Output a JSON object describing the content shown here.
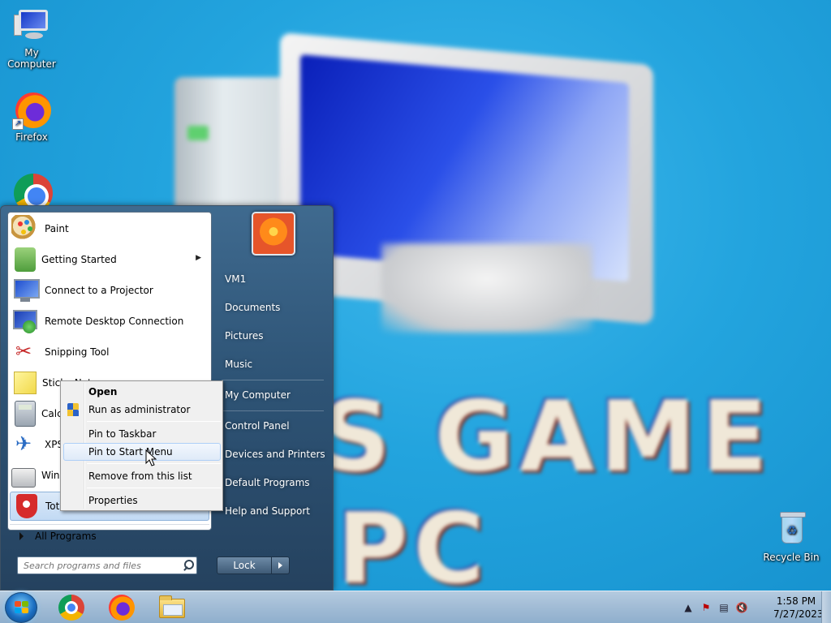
{
  "desktop": {
    "wallpaper_text": [
      "S GAME",
      "PC"
    ],
    "icons": [
      {
        "label": "My Computer",
        "icon": "computer-icon"
      },
      {
        "label": "Firefox",
        "icon": "firefox-icon"
      },
      {
        "label": "",
        "icon": "chrome-icon"
      },
      {
        "label": "Recycle Bin",
        "icon": "recycle-bin-icon"
      }
    ]
  },
  "start_menu": {
    "programs": [
      {
        "label": "Paint",
        "icon": "paint-icon"
      },
      {
        "label": "Getting Started",
        "icon": "getting-started-icon",
        "has_submenu": true
      },
      {
        "label": "Connect to a Projector",
        "icon": "projector-icon"
      },
      {
        "label": "Remote Desktop Connection",
        "icon": "remote-desktop-icon"
      },
      {
        "label": "Snipping Tool",
        "icon": "snipping-tool-icon"
      },
      {
        "label": "Sticky Notes",
        "icon": "sticky-notes-icon"
      },
      {
        "label": "Calculator",
        "icon": "calculator-icon"
      },
      {
        "label": "XPS Viewer",
        "icon": "xps-viewer-icon"
      },
      {
        "label": "Windows Fax and Scan",
        "icon": "fax-scan-icon"
      },
      {
        "label": "Total",
        "icon": "total-security-icon",
        "selected": true
      }
    ],
    "all_programs_label": "All Programs",
    "search_placeholder": "Search programs and files",
    "right_links": [
      "VM1",
      "Documents",
      "Pictures",
      "Music",
      "My Computer",
      "Control Panel",
      "Devices and Printers",
      "Default Programs",
      "Help and Support"
    ],
    "lock_label": "Lock"
  },
  "context_menu": {
    "items": [
      {
        "label": "Open",
        "bold": true
      },
      {
        "label": "Run as administrator",
        "icon": "uac-shield-icon"
      },
      {
        "label": "Pin to Taskbar"
      },
      {
        "label": "Pin to Start Menu",
        "hovered": true
      },
      {
        "label": "Remove from this list"
      },
      {
        "label": "Properties"
      }
    ]
  },
  "taskbar": {
    "pinned": [
      "chrome-icon",
      "firefox-icon",
      "file-explorer-icon"
    ],
    "tray_icons": [
      "show-hidden-icons-chevron",
      "action-center-flag-icon",
      "network-icon",
      "volume-muted-icon"
    ],
    "time": "1:58 PM",
    "date": "7/27/2023"
  }
}
